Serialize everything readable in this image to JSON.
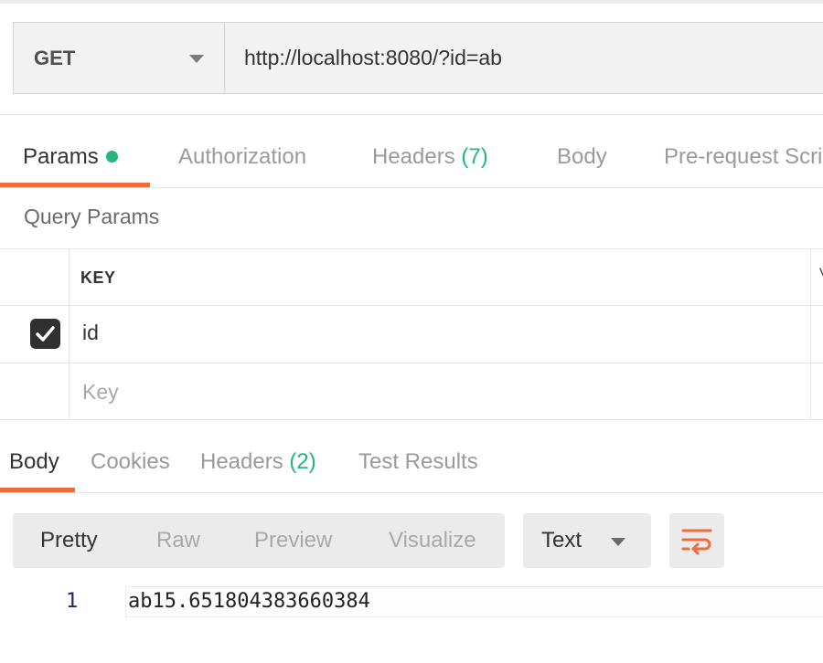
{
  "request": {
    "method": "GET",
    "url": "http://localhost:8080/?id=ab"
  },
  "request_tabs": [
    {
      "label": "Params",
      "active": true,
      "has_dot": true
    },
    {
      "label": "Authorization"
    },
    {
      "label": "Headers",
      "count": "(7)"
    },
    {
      "label": "Body"
    },
    {
      "label": "Pre-request Scri"
    }
  ],
  "query_params": {
    "title": "Query Params",
    "key_header": "KEY",
    "rows": [
      {
        "checked": true,
        "key": "id"
      }
    ],
    "new_key_placeholder": "Key",
    "cutoff_header_char": "V"
  },
  "response_tabs": [
    {
      "label": "Body",
      "active": true
    },
    {
      "label": "Cookies"
    },
    {
      "label": "Headers",
      "count": "(2)"
    },
    {
      "label": "Test Results"
    }
  ],
  "view_modes": [
    "Pretty",
    "Raw",
    "Preview",
    "Visualize"
  ],
  "active_view_mode": "Pretty",
  "format": "Text",
  "response_body": {
    "line_number": "1",
    "text": "ab15.651804383660384"
  },
  "colors": {
    "accent": "#f26b3a",
    "success": "#26b47f"
  },
  "icons": {
    "method_dropdown": "chevron-down-icon",
    "checkbox": "check-icon",
    "wrap": "wrap-lines-icon",
    "format_dropdown": "chevron-down-icon"
  }
}
